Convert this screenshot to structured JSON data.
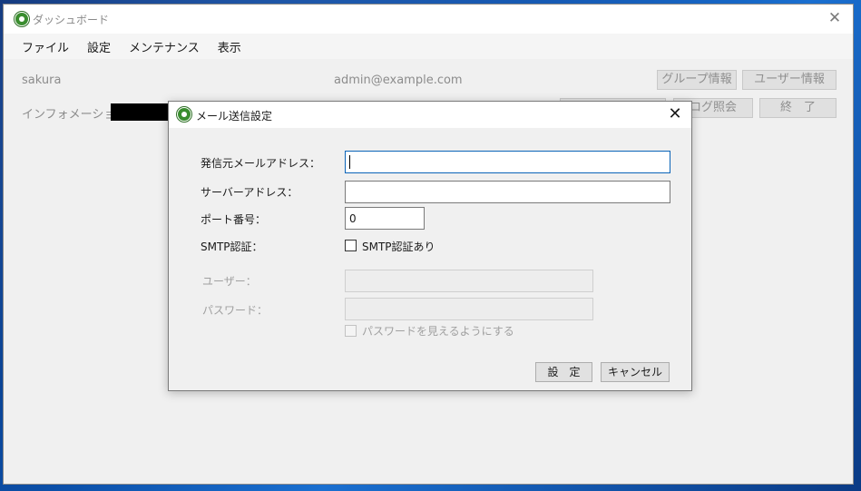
{
  "window": {
    "title": "ダッシュボード",
    "close_glyph": "✕"
  },
  "menu": [
    "ファイル",
    "設定",
    "メンテナンス",
    "表示"
  ],
  "main": {
    "user_name": "sakura",
    "email": "admin@example.com",
    "info_label": "インフォメーショ",
    "buttons": {
      "group_info": "グループ情報",
      "user_info": "ユーザー情報",
      "log_view": "ログ照会",
      "exit": "終　了"
    }
  },
  "dialog": {
    "title": "メール送信設定",
    "close_glyph": "✕",
    "fields": {
      "sender_label": "発信元メールアドレス：",
      "sender_value": "",
      "server_label": "サーバーアドレス：",
      "server_value": "",
      "port_label": "ポート番号：",
      "port_value": "0",
      "smtp_auth_label": "SMTP認証：",
      "smtp_auth_checkbox": "SMTP認証あり",
      "user_label": "ユーザー：",
      "user_value": "",
      "password_label": "パスワード：",
      "password_value": "",
      "show_password_checkbox": "パスワードを見えるようにする"
    },
    "buttons": {
      "set": "設　定",
      "cancel": "キャンセル"
    }
  }
}
